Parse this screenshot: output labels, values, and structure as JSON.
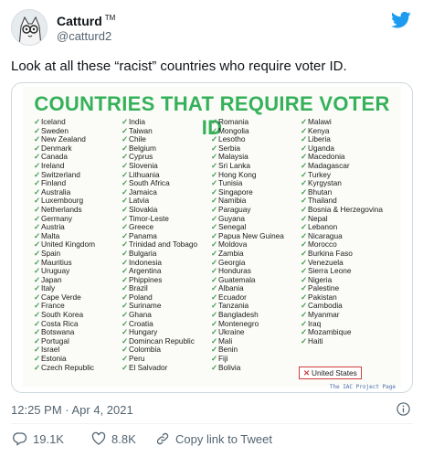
{
  "author": {
    "name": "Catturd",
    "tm": "TM",
    "handle": "@catturd2"
  },
  "tweet": {
    "text": "Look at all these “racist” countries who require voter ID."
  },
  "poster": {
    "title": "COUNTRIES THAT REQUIRE VOTER ID",
    "columns": [
      [
        "Iceland",
        "Sweden",
        "New Zealand",
        "Denmark",
        "Canada",
        "Ireland",
        "Switzerland",
        "Finland",
        "Australia",
        "Luxembourg",
        "Netherlands",
        "Germany",
        "Austria",
        "Malta",
        "United Kingdom",
        "Spain",
        "Mauritius",
        "Uruguay",
        "Japan",
        "Italy",
        "Cape Verde",
        "France",
        "South Korea",
        "Costa Rica",
        "Botswana",
        "Portugal",
        "Israel",
        "Estonia",
        "Czech Republic"
      ],
      [
        "India",
        "Taiwan",
        "Chile",
        "Belgium",
        "Cyprus",
        "Slovenia",
        "Lithuania",
        "South Africa",
        "Jamaica",
        "Latvia",
        "Slovakia",
        "Timor-Leste",
        "Greece",
        "Panama",
        "Trinidad and Tobago",
        "Bulgaria",
        "Indonesia",
        "Argentina",
        "Phippines",
        "Brazil",
        "Poland",
        "Suriname",
        "Ghana",
        "Croatia",
        "Hungary",
        "Domincan Republic",
        "Colombia",
        "Peru",
        "El Salvador"
      ],
      [
        "Romania",
        "Mongolia",
        "Lesotho",
        "Serbia",
        "Malaysia",
        "Sri Lanka",
        "Hong Kong",
        "Tunisia",
        "Singapore",
        "Namibia",
        "Paraguay",
        "Guyana",
        "Senegal",
        "Papua New Guinea",
        "Moldova",
        "Zambia",
        "Georgia",
        "Honduras",
        "Guatemala",
        "Albania",
        "Ecuador",
        "Tanzania",
        "Bangladesh",
        "Montenegro",
        "Ukraine",
        "Mali",
        "Benin",
        "Fiji",
        "Bolivia"
      ],
      [
        "Malawi",
        "Kenya",
        "Liberia",
        "Uganda",
        "Macedonia",
        "Madagascar",
        "Turkey",
        "Kyrgystan",
        "Bhutan",
        "Thailand",
        "Bosnia & Herzegovina",
        "Nepal",
        "Lebanon",
        "Nicaragua",
        "Morocco",
        "Burkina Faso",
        "Venezuela",
        "Sierra Leone",
        "Nigeria",
        "Palestine",
        "Pakistan",
        "Cambodia",
        "Myanmar",
        "Iraq",
        "Mozambique",
        "Haiti"
      ]
    ],
    "exception": "United States",
    "credit": "The IAC Project Page"
  },
  "meta": {
    "timestamp": "12:25 PM · Apr 4, 2021"
  },
  "actions": {
    "replies": "19.1K",
    "likes": "8.8K",
    "copy": "Copy link to Tweet"
  },
  "colors": {
    "title_green": "#35b15a",
    "check_green": "#3b9c4c",
    "twitter_blue": "#1d9bf0",
    "x_red": "#d23c3c"
  },
  "icons": [
    "twitter-bird-icon",
    "info-icon",
    "reply-icon",
    "heart-icon",
    "link-icon"
  ]
}
